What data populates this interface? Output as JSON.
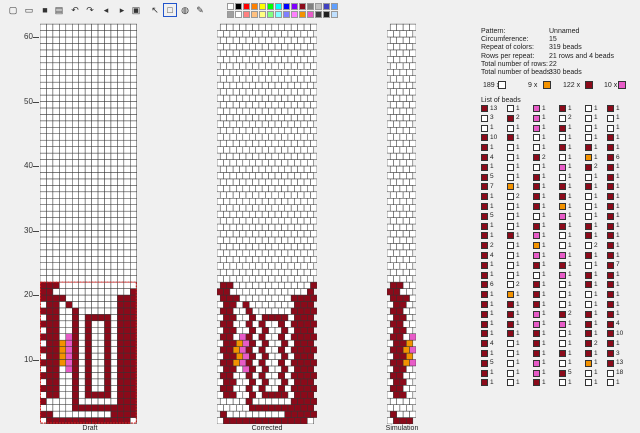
{
  "colors": {
    "white": "#ffffff",
    "maroon": "#8b0a1a",
    "orange": "#f39200",
    "pink": "#e75bc7",
    "grid": "#333333",
    "red_frame": "#e02020"
  },
  "toolbar": {
    "buttons": [
      {
        "name": "new-file-icon",
        "glyph": "▢"
      },
      {
        "name": "open-folder-icon",
        "glyph": "▭"
      },
      {
        "name": "save-icon",
        "glyph": "■"
      },
      {
        "name": "print-icon",
        "glyph": "▤"
      },
      {
        "name": "undo-icon",
        "glyph": "↶"
      },
      {
        "name": "redo-icon",
        "glyph": "↷"
      },
      {
        "name": "shift-left-icon",
        "glyph": "◂"
      },
      {
        "name": "shift-right-icon",
        "glyph": "▸"
      },
      {
        "name": "copy-icon",
        "glyph": "▣"
      },
      {
        "name": "pointer-icon",
        "glyph": "↖"
      },
      {
        "name": "select-rect-icon",
        "glyph": "□"
      },
      {
        "name": "fill-icon",
        "glyph": "◍"
      },
      {
        "name": "pipette-icon",
        "glyph": "✎"
      }
    ],
    "palette": [
      "#ffffff",
      "#000000",
      "#ff0000",
      "#ff8000",
      "#ffff00",
      "#00ff00",
      "#00ffff",
      "#0000ff",
      "#8000ff",
      "#8b0a1a",
      "#808080",
      "#c0c0c0",
      "#4040c0",
      "#60a0ff",
      "#a0a0a0",
      "#ffffff",
      "#ff8080",
      "#ffc080",
      "#ffff80",
      "#80ff80",
      "#80ffff",
      "#8080ff",
      "#ff80ff",
      "#f39200",
      "#e75bc7",
      "#404040",
      "#202020",
      "#c0e0ff"
    ]
  },
  "ruler": {
    "labels": [
      "60",
      "50",
      "40",
      "30",
      "20",
      "10"
    ]
  },
  "panels": {
    "draft_label": "Draft",
    "corrected_label": "Corrected",
    "simulation_label": "Simulation"
  },
  "info": [
    {
      "k": "Pattern:",
      "v": "Unnamed"
    },
    {
      "k": "Circumference:",
      "v": "15"
    },
    {
      "k": "Repeat of colors:",
      "v": "319 beads"
    },
    {
      "k": "Rows per repeat:",
      "v": "21 rows and 4 beads"
    },
    {
      "k": "Total number of rows:",
      "v": "22"
    },
    {
      "k": "Total number of beads:",
      "v": "330 beads"
    }
  ],
  "color_stats": [
    {
      "count": "189 x",
      "color": "white"
    },
    {
      "count": "9 x",
      "color": "orange"
    },
    {
      "count": "122 x",
      "color": "maroon"
    },
    {
      "count": "10 x",
      "color": "pink"
    }
  ],
  "list_title": "List of beads",
  "bead_list": [
    [
      [
        "m",
        "13"
      ],
      [
        "w",
        "3"
      ],
      [
        "w",
        "1"
      ],
      [
        "m",
        "10"
      ],
      [
        "m",
        "1"
      ],
      [
        "m",
        "4"
      ],
      [
        "m",
        "1"
      ],
      [
        "m",
        "5"
      ],
      [
        "m",
        "7"
      ],
      [
        "m",
        "1"
      ],
      [
        "m",
        "1"
      ],
      [
        "m",
        "5"
      ],
      [
        "m",
        "1"
      ],
      [
        "m",
        "1"
      ],
      [
        "m",
        "2"
      ],
      [
        "m",
        "4"
      ],
      [
        "m",
        "1"
      ],
      [
        "m",
        "1"
      ],
      [
        "m",
        "6"
      ],
      [
        "m",
        "1"
      ],
      [
        "m",
        "1"
      ],
      [
        "m",
        "1"
      ],
      [
        "m",
        "1"
      ],
      [
        "m",
        "1"
      ],
      [
        "m",
        "4"
      ],
      [
        "m",
        "1"
      ],
      [
        "m",
        "5"
      ],
      [
        "m",
        "1"
      ],
      [
        "m",
        "1"
      ]
    ],
    [
      [
        "w",
        "1"
      ],
      [
        "m",
        "2"
      ],
      [
        "w",
        "1"
      ],
      [
        "m",
        "1"
      ],
      [
        "w",
        "1"
      ],
      [
        "w",
        "1"
      ],
      [
        "w",
        "1"
      ],
      [
        "w",
        "1"
      ],
      [
        "o",
        "1"
      ],
      [
        "w",
        "2"
      ],
      [
        "w",
        "1"
      ],
      [
        "w",
        "1"
      ],
      [
        "w",
        "1"
      ],
      [
        "m",
        "1"
      ],
      [
        "w",
        "1"
      ],
      [
        "w",
        "1"
      ],
      [
        "w",
        "1"
      ],
      [
        "w",
        "1"
      ],
      [
        "w",
        "2"
      ],
      [
        "o",
        "1"
      ],
      [
        "m",
        "1"
      ],
      [
        "m",
        "1"
      ],
      [
        "m",
        "1"
      ],
      [
        "m",
        "1"
      ],
      [
        "w",
        "1"
      ],
      [
        "w",
        "1"
      ],
      [
        "w",
        "1"
      ],
      [
        "w",
        "1"
      ],
      [
        "w",
        "1"
      ]
    ],
    [
      [
        "p",
        "1"
      ],
      [
        "p",
        "1"
      ],
      [
        "p",
        "1"
      ],
      [
        "w",
        "1"
      ],
      [
        "w",
        "1"
      ],
      [
        "m",
        "2"
      ],
      [
        "w",
        "1"
      ],
      [
        "m",
        "1"
      ],
      [
        "m",
        "1"
      ],
      [
        "m",
        "1"
      ],
      [
        "m",
        "1"
      ],
      [
        "w",
        "1"
      ],
      [
        "m",
        "1"
      ],
      [
        "p",
        "1"
      ],
      [
        "o",
        "1"
      ],
      [
        "p",
        "1"
      ],
      [
        "m",
        "1"
      ],
      [
        "w",
        "1"
      ],
      [
        "m",
        "1"
      ],
      [
        "m",
        "1"
      ],
      [
        "m",
        "1"
      ],
      [
        "p",
        "1"
      ],
      [
        "p",
        "1"
      ],
      [
        "m",
        "1"
      ],
      [
        "m",
        "1"
      ],
      [
        "m",
        "1"
      ],
      [
        "p",
        "1"
      ],
      [
        "p",
        "1"
      ],
      [
        "m",
        "1"
      ]
    ],
    [
      [
        "m",
        "1"
      ],
      [
        "w",
        "2"
      ],
      [
        "m",
        "1"
      ],
      [
        "w",
        "1"
      ],
      [
        "m",
        "1"
      ],
      [
        "w",
        "1"
      ],
      [
        "p",
        "1"
      ],
      [
        "w",
        "1"
      ],
      [
        "m",
        "1"
      ],
      [
        "m",
        "1"
      ],
      [
        "o",
        "1"
      ],
      [
        "p",
        "1"
      ],
      [
        "m",
        "1"
      ],
      [
        "w",
        "1"
      ],
      [
        "w",
        "1"
      ],
      [
        "p",
        "1"
      ],
      [
        "m",
        "1"
      ],
      [
        "p",
        "1"
      ],
      [
        "w",
        "1"
      ],
      [
        "w",
        "1"
      ],
      [
        "w",
        "1"
      ],
      [
        "m",
        "2"
      ],
      [
        "p",
        "1"
      ],
      [
        "w",
        "1"
      ],
      [
        "w",
        "1"
      ],
      [
        "m",
        "1"
      ],
      [
        "w",
        "1"
      ],
      [
        "m",
        "5"
      ],
      [
        "w",
        "1"
      ]
    ],
    [
      [
        "w",
        "1"
      ],
      [
        "w",
        "1"
      ],
      [
        "w",
        "1"
      ],
      [
        "w",
        "1"
      ],
      [
        "m",
        "1"
      ],
      [
        "o",
        "1"
      ],
      [
        "m",
        "2"
      ],
      [
        "w",
        "1"
      ],
      [
        "m",
        "1"
      ],
      [
        "w",
        "1"
      ],
      [
        "w",
        "1"
      ],
      [
        "w",
        "1"
      ],
      [
        "m",
        "1"
      ],
      [
        "m",
        "1"
      ],
      [
        "w",
        "2"
      ],
      [
        "m",
        "1"
      ],
      [
        "w",
        "1"
      ],
      [
        "m",
        "1"
      ],
      [
        "m",
        "1"
      ],
      [
        "w",
        "1"
      ],
      [
        "w",
        "1"
      ],
      [
        "m",
        "1"
      ],
      [
        "m",
        "1"
      ],
      [
        "m",
        "1"
      ],
      [
        "m",
        "2"
      ],
      [
        "m",
        "1"
      ],
      [
        "o",
        "1"
      ],
      [
        "w",
        "1"
      ],
      [
        "w",
        "1"
      ]
    ],
    [
      [
        "m",
        "1"
      ],
      [
        "w",
        "1"
      ],
      [
        "w",
        "1"
      ],
      [
        "m",
        "1"
      ],
      [
        "m",
        "1"
      ],
      [
        "m",
        "6"
      ],
      [
        "m",
        "1"
      ],
      [
        "m",
        "1"
      ],
      [
        "m",
        "1"
      ],
      [
        "m",
        "1"
      ],
      [
        "m",
        "1"
      ],
      [
        "m",
        "1"
      ],
      [
        "m",
        "1"
      ],
      [
        "m",
        "1"
      ],
      [
        "m",
        "1"
      ],
      [
        "m",
        "1"
      ],
      [
        "m",
        "7"
      ],
      [
        "m",
        "1"
      ],
      [
        "m",
        "1"
      ],
      [
        "m",
        "1"
      ],
      [
        "m",
        "1"
      ],
      [
        "m",
        "1"
      ],
      [
        "m",
        "4"
      ],
      [
        "m",
        "10"
      ],
      [
        "m",
        "1"
      ],
      [
        "m",
        "3"
      ],
      [
        "m",
        "13"
      ],
      [
        "w",
        "18"
      ],
      [
        "w",
        "1"
      ]
    ]
  ]
}
